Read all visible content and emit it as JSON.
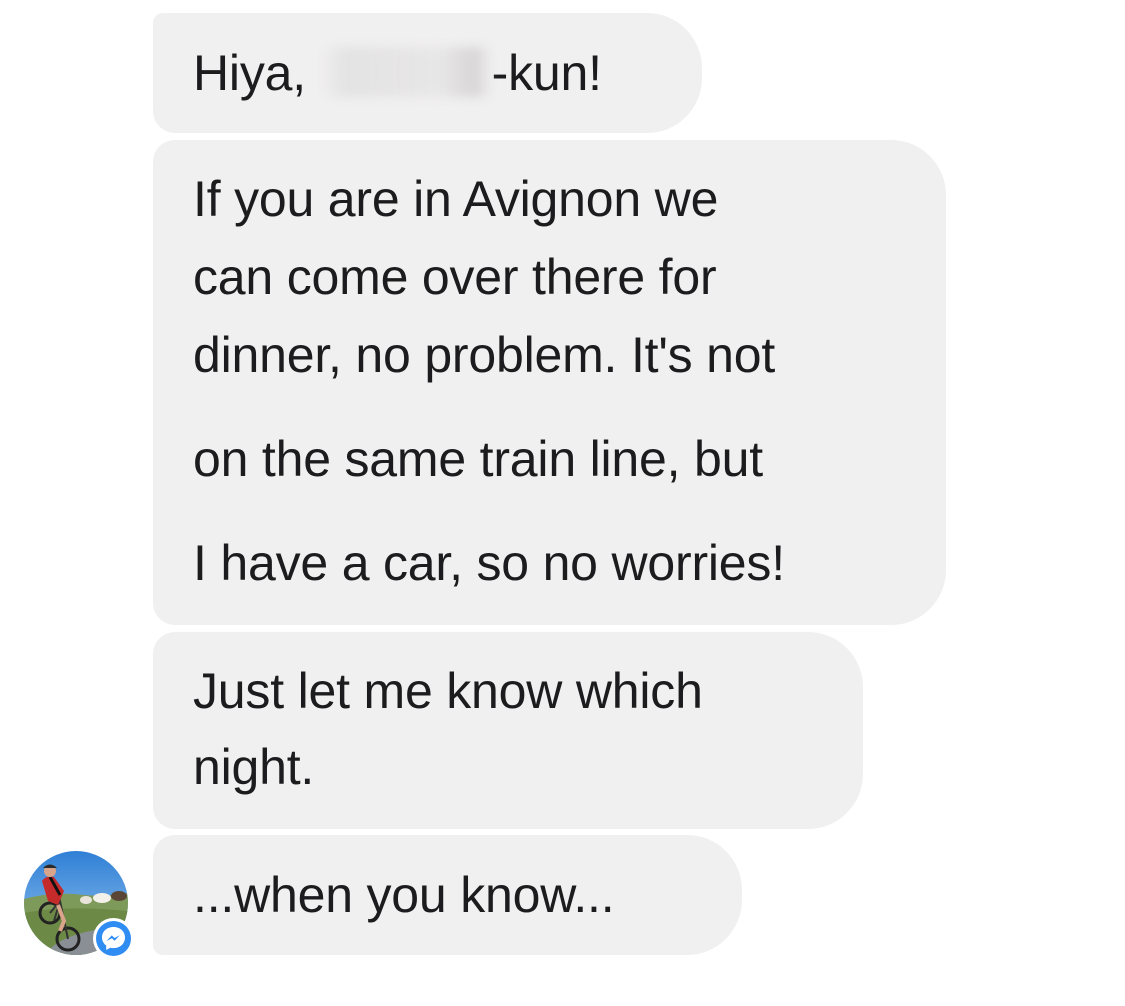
{
  "messages": [
    {
      "lines": [
        "Hiya,",
        "-kun!"
      ]
    },
    {
      "lines": [
        "If you are in Avignon we",
        "can come over there for",
        "dinner, no problem. It's not",
        "on the same train line, but",
        "I have a car, so no worries!"
      ]
    },
    {
      "lines": [
        "Just let me know which",
        "night."
      ]
    },
    {
      "lines": [
        "...when you know..."
      ]
    }
  ],
  "sender": {
    "avatar_icon": "cyclist-avatar",
    "badge_icon": "messenger-icon",
    "badge_color": "#2e8cf3"
  },
  "colors": {
    "bubble_background": "#f1f0f0",
    "text": "#1c1c1e"
  }
}
